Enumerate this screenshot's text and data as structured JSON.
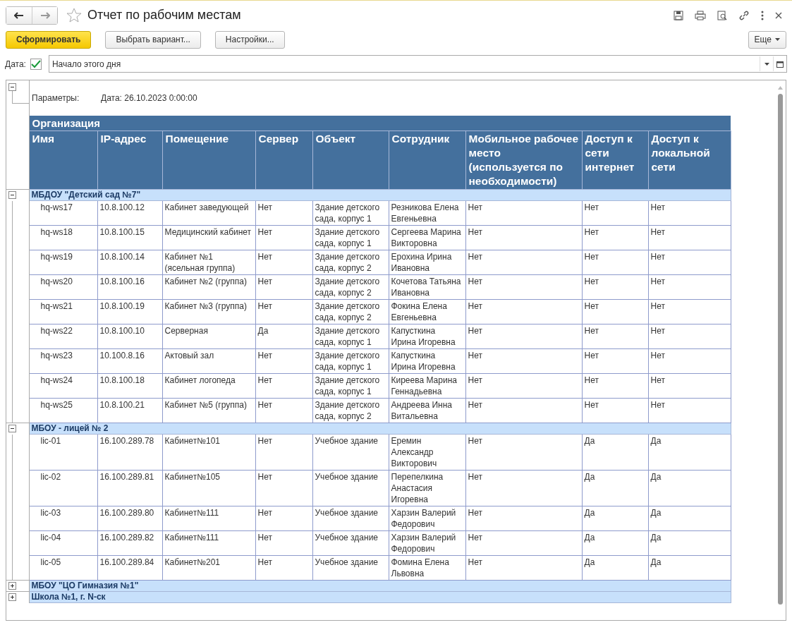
{
  "window": {
    "title": "Отчет по рабочим местам",
    "favorite": false
  },
  "toolbar": {
    "buttons": [
      {
        "label": "Сформировать",
        "kind": "primary"
      },
      {
        "label": "Выбрать вариант...",
        "kind": "normal"
      },
      {
        "label": "Настройки...",
        "kind": "normal"
      }
    ],
    "more": "Еще"
  },
  "date_filter": {
    "label": "Дата:",
    "checked": true,
    "value": "Начало этого дня"
  },
  "report": {
    "parameters": {
      "expanded": true,
      "label": "Параметры:",
      "value": "Дата: 26.10.2023 0:00:00"
    },
    "group_header": "Организация",
    "columns": [
      "Имя",
      "IP-адрес",
      "Помещение",
      "Сервер",
      "Объект",
      "Сотрудник",
      "Мобильное рабочее место (используется по необходимости)",
      "Доступ к сети интернет",
      "Доступ к локальной сети"
    ],
    "groups": [
      {
        "name": "МБДОУ \"Детский сад №7\"",
        "expanded": true,
        "rows": [
          [
            "hq-ws17",
            "10.8.100.12",
            "Кабинет заведующей",
            "Нет",
            "Здание детского сада, корпус 1",
            "Резникова Елена Евгеньевна",
            "Нет",
            "Нет",
            "Нет"
          ],
          [
            "hq-ws18",
            "10.8.100.15",
            "Медицинский кабинет",
            "Нет",
            "Здание детского сада, корпус 1",
            "Сергеева Марина Викторовна",
            "Нет",
            "Нет",
            "Нет"
          ],
          [
            "hq-ws19",
            "10.8.100.14",
            "Кабинет №1 (ясельная группа)",
            "Нет",
            "Здание детского сада, корпус 2",
            "Ерохина Ирина Ивановна",
            "Нет",
            "Нет",
            "Нет"
          ],
          [
            "hq-ws20",
            "10.8.100.16",
            "Кабинет №2 (группа)",
            "Нет",
            "Здание детского сада, корпус 2",
            "Кочетова Татьяна Ивановна",
            "Нет",
            "Нет",
            "Нет"
          ],
          [
            "hq-ws21",
            "10.8.100.19",
            "Кабинет №3 (группа)",
            "Нет",
            "Здание детского сада, корпус 2",
            "Фокина Елена Евгеньевна",
            "Нет",
            "Нет",
            "Нет"
          ],
          [
            "hq-ws22",
            "10.8.100.10",
            "Серверная",
            "Да",
            "Здание детского сада, корпус 1",
            "Капусткина Ирина Игоревна",
            "Нет",
            "Нет",
            "Нет"
          ],
          [
            "hq-ws23",
            "10.100.8.16",
            "Актовый зал",
            "Нет",
            "Здание детского сада, корпус 1",
            "Капусткина Ирина Игоревна",
            "Нет",
            "Нет",
            "Нет"
          ],
          [
            "hq-ws24",
            "10.8.100.18",
            "Кабинет логопеда",
            "Нет",
            "Здание детского сада, корпус 1",
            "Киреева Марина Геннадьевна",
            "Нет",
            "Нет",
            "Нет"
          ],
          [
            "hq-ws25",
            "10.8.100.21",
            "Кабинет №5 (группа)",
            "Нет",
            "Здание детского сада, корпус 2",
            "Андреева Инна Витальевна",
            "Нет",
            "Нет",
            "Нет"
          ]
        ]
      },
      {
        "name": "МБОУ - лицей № 2",
        "expanded": true,
        "rows": [
          [
            "lic-01",
            "16.100.289.78",
            "Кабинет№101",
            "Нет",
            "Учебное здание",
            "Еремин Александр Викторович",
            "Нет",
            "Да",
            "Да"
          ],
          [
            "lic-02",
            "16.100.289.81",
            "Кабинет№105",
            "Нет",
            "Учебное здание",
            "Перепелкина Анастасия Игоревна",
            "Нет",
            "Да",
            "Да"
          ],
          [
            "lic-03",
            "16.100.289.80",
            "Кабинет№111",
            "Нет",
            "Учебное здание",
            "Харзин Валерий Федорович",
            "Нет",
            "Да",
            "Да"
          ],
          [
            "lic-04",
            "16.100.289.82",
            "Кабинет№111",
            "Нет",
            "Учебное здание",
            "Харзин Валерий Федорович",
            "Нет",
            "Да",
            "Да"
          ],
          [
            "lic-05",
            "16.100.289.84",
            "Кабинет№201",
            "Нет",
            "Учебное здание",
            "Фомина Елена Львовна",
            "Нет",
            "Да",
            "Да"
          ]
        ]
      },
      {
        "name": "МБОУ \"ЦО Гимназия №1\"",
        "expanded": false
      },
      {
        "name": "Школа №1, г. N-ск",
        "expanded": false
      }
    ]
  }
}
